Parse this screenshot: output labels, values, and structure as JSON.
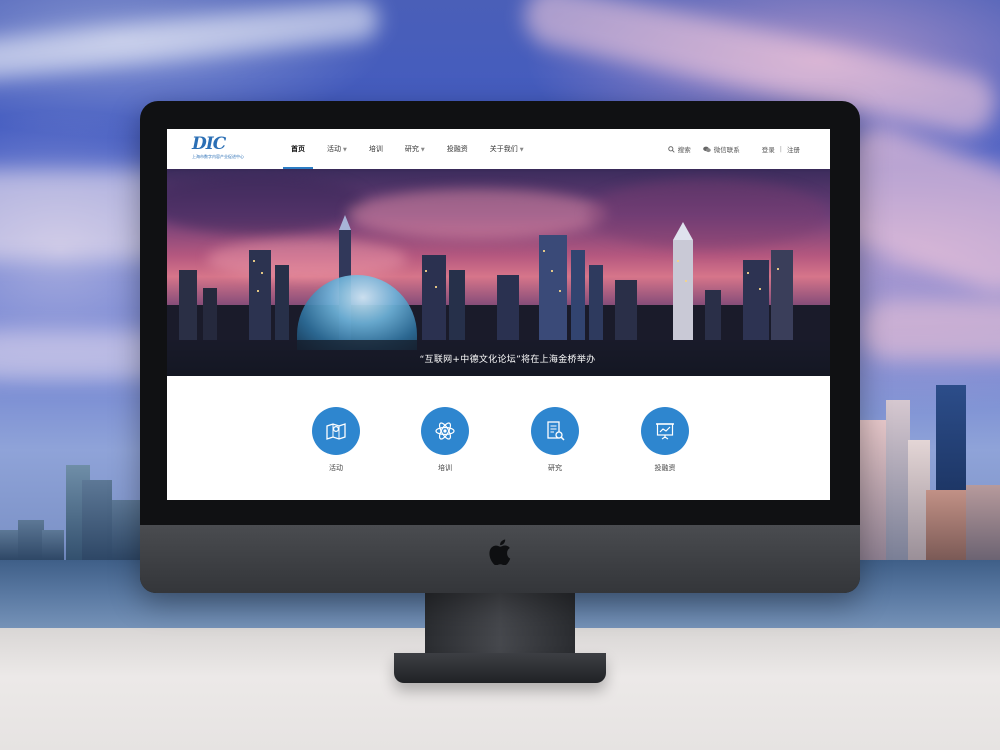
{
  "site": {
    "logo_mark": "DIC",
    "logo_subtitle": "上海市数字内容产业促进中心"
  },
  "nav": {
    "items": [
      {
        "label": "首页",
        "active": true,
        "dropdown": false
      },
      {
        "label": "活动",
        "active": false,
        "dropdown": true
      },
      {
        "label": "培训",
        "active": false,
        "dropdown": false
      },
      {
        "label": "研究",
        "active": false,
        "dropdown": true
      },
      {
        "label": "投融资",
        "active": false,
        "dropdown": false
      },
      {
        "label": "关于我们",
        "active": false,
        "dropdown": true
      }
    ],
    "search_label": "搜索",
    "wechat_label": "微信联系",
    "login_label": "登录",
    "divider": "|",
    "register_label": "注册"
  },
  "banner": {
    "caption": "“互联网+中德文化论坛”将在上海金桥举办"
  },
  "features": [
    {
      "label": "活动",
      "icon": "map-icon"
    },
    {
      "label": "培训",
      "icon": "atom-icon"
    },
    {
      "label": "研究",
      "icon": "document-search-icon"
    },
    {
      "label": "投融资",
      "icon": "presentation-chart-icon"
    }
  ],
  "colors": {
    "accent": "#2e86cf",
    "nav_active_underline": "#2b7cc4"
  }
}
